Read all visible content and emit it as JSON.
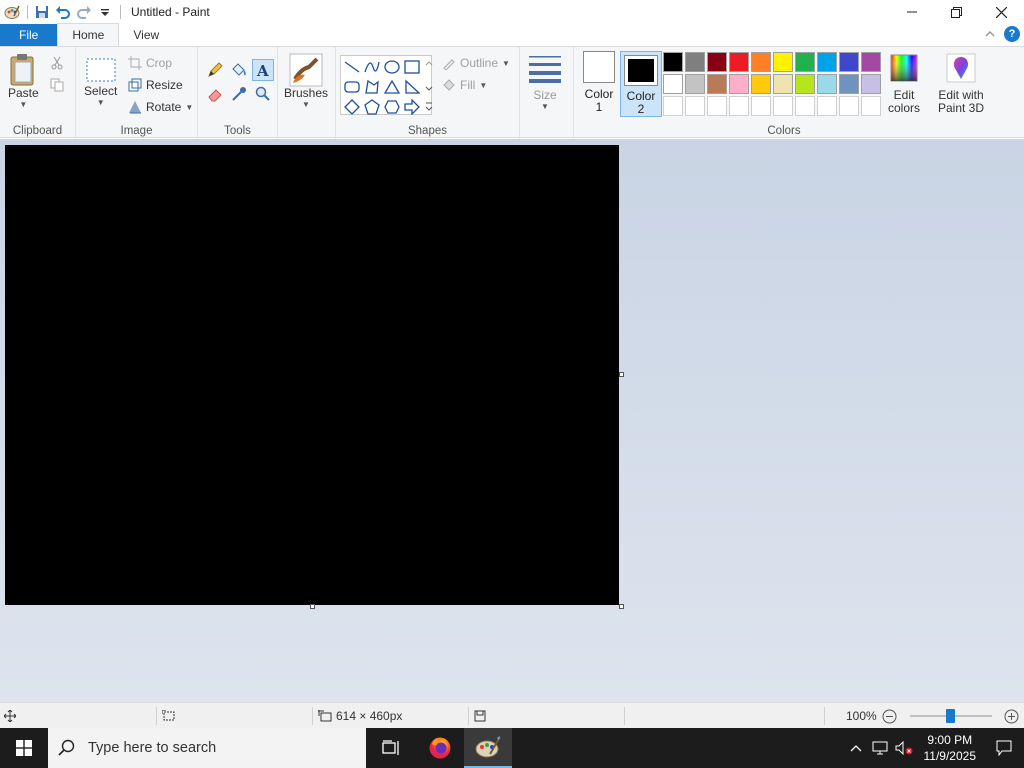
{
  "window": {
    "title": "Untitled - Paint"
  },
  "tabs": {
    "file": "File",
    "home": "Home",
    "view": "View"
  },
  "clipboard": {
    "paste": "Paste",
    "group": "Clipboard"
  },
  "image": {
    "select": "Select",
    "crop": "Crop",
    "resize": "Resize",
    "rotate": "Rotate",
    "group": "Image"
  },
  "tools": {
    "group": "Tools"
  },
  "brushes": {
    "label": "Brushes"
  },
  "shapes": {
    "outline": "Outline",
    "fill": "Fill",
    "group": "Shapes"
  },
  "size": {
    "label": "Size"
  },
  "colors": {
    "color1_line1": "Color",
    "color1_line2": "1",
    "color2_line1": "Color",
    "color2_line2": "2",
    "edit_line1": "Edit",
    "edit_line2": "colors",
    "paint3d_line1": "Edit with",
    "paint3d_line2": "Paint 3D",
    "group": "Colors",
    "color1_value": "#ffffff",
    "color2_value": "#000000",
    "palette_row1": [
      "#000000",
      "#7f7f7f",
      "#880015",
      "#ed1c24",
      "#ff7f27",
      "#fff200",
      "#22b14c",
      "#00a2e8",
      "#3f48cc",
      "#a349a4"
    ],
    "palette_row2": [
      "#ffffff",
      "#c3c3c3",
      "#b97a57",
      "#ffaec9",
      "#ffc90e",
      "#efe4b0",
      "#b5e61d",
      "#99d9ea",
      "#7092be",
      "#c8bfe7"
    ]
  },
  "canvas": {
    "fill": "#000000"
  },
  "status": {
    "dimensions": "614 × 460px",
    "zoom": "100%"
  },
  "taskbar": {
    "search_placeholder": "Type here to search",
    "time": "9:00 PM",
    "date": "11/9/2025"
  }
}
